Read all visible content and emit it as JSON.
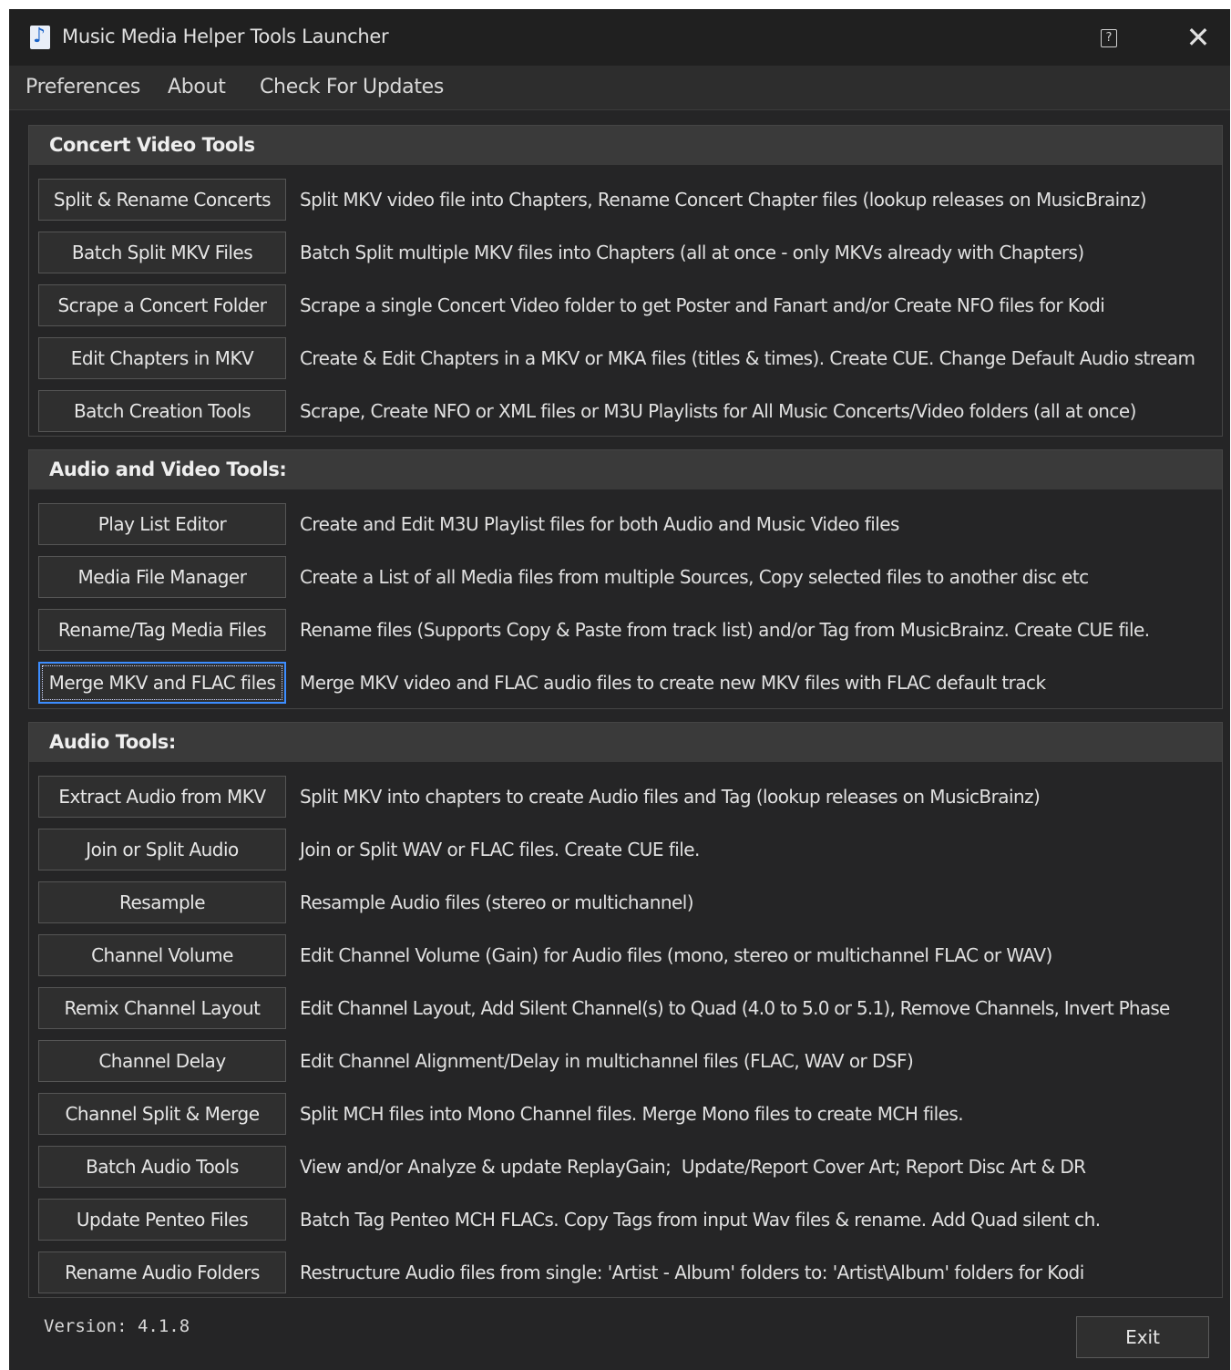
{
  "window": {
    "title": "Music Media Helper Tools Launcher",
    "app_icon": "music-note-icon",
    "help_icon": "help-icon",
    "close_icon": "close-icon",
    "help_glyph": "?",
    "close_glyph": "✕"
  },
  "menu": {
    "items": [
      "Preferences",
      "About",
      "Check For Updates"
    ]
  },
  "groups": [
    {
      "title": "Concert Video Tools",
      "tools": [
        {
          "label": "Split & Rename Concerts",
          "desc": "Split MKV video file into Chapters, Rename Concert Chapter files (lookup releases on MusicBrainz)"
        },
        {
          "label": "Batch Split MKV Files",
          "desc": "Batch Split multiple MKV files into Chapters (all at once - only MKVs already with Chapters)"
        },
        {
          "label": "Scrape a Concert Folder",
          "desc": "Scrape a single Concert Video folder to get Poster and Fanart and/or Create NFO files for Kodi"
        },
        {
          "label": "Edit Chapters in MKV",
          "desc": "Create & Edit Chapters in a MKV or MKA files (titles & times). Create CUE. Change Default Audio stream"
        },
        {
          "label": "Batch Creation Tools",
          "desc": "Scrape, Create NFO or XML files or M3U Playlists for All Music Concerts/Video folders (all at once)"
        }
      ]
    },
    {
      "title": "Audio and Video Tools:",
      "tools": [
        {
          "label": "Play List Editor",
          "desc": "Create and Edit M3U Playlist files for both Audio and Music Video files"
        },
        {
          "label": "Media File Manager",
          "desc": "Create a List of all Media files from multiple Sources, Copy selected files to another disc etc"
        },
        {
          "label": "Rename/Tag Media Files",
          "desc": "Rename files (Supports Copy & Paste from track list) and/or Tag from MusicBrainz. Create CUE file."
        },
        {
          "label": "Merge MKV and FLAC files",
          "desc": "Merge MKV video and FLAC audio files to create new MKV files with FLAC default track",
          "focused": true
        }
      ]
    },
    {
      "title": "Audio Tools:",
      "tools": [
        {
          "label": "Extract Audio from MKV",
          "desc": "Split MKV into chapters to create Audio files and Tag (lookup releases on MusicBrainz)"
        },
        {
          "label": "Join or Split Audio",
          "desc": "Join or Split WAV or FLAC files. Create CUE file."
        },
        {
          "label": "Resample",
          "desc": "Resample Audio files (stereo or multichannel)"
        },
        {
          "label": "Channel Volume",
          "desc": "Edit Channel Volume (Gain) for Audio files (mono, stereo or multichannel FLAC or WAV)"
        },
        {
          "label": "Remix Channel Layout",
          "desc": "Edit Channel Layout, Add Silent Channel(s) to Quad (4.0 to 5.0 or 5.1), Remove Channels, Invert Phase"
        },
        {
          "label": "Channel Delay",
          "desc": "Edit Channel Alignment/Delay in multichannel files (FLAC, WAV or DSF)"
        },
        {
          "label": "Channel Split & Merge",
          "desc": "Split MCH files into Mono Channel files. Merge Mono files to create MCH files."
        },
        {
          "label": "Batch Audio Tools",
          "desc": "View and/or Analyze & update ReplayGain;  Update/Report Cover Art; Report Disc Art & DR"
        },
        {
          "label": "Update Penteo Files",
          "desc": "Batch Tag Penteo MCH FLACs. Copy Tags from input Wav files & rename. Add Quad silent ch."
        },
        {
          "label": "Rename Audio Folders",
          "desc": "Restructure Audio files from single: 'Artist - Album' folders to: 'Artist\\Album' folders for Kodi"
        }
      ]
    }
  ],
  "footer": {
    "version": "Version: 4.1.8",
    "exit_label": "Exit"
  },
  "colors": {
    "background": "#252526",
    "titlebar": "#202020",
    "group_header": "#3a3a3a",
    "button": "#2f2f2f",
    "focus_accent": "#3c8dff"
  }
}
